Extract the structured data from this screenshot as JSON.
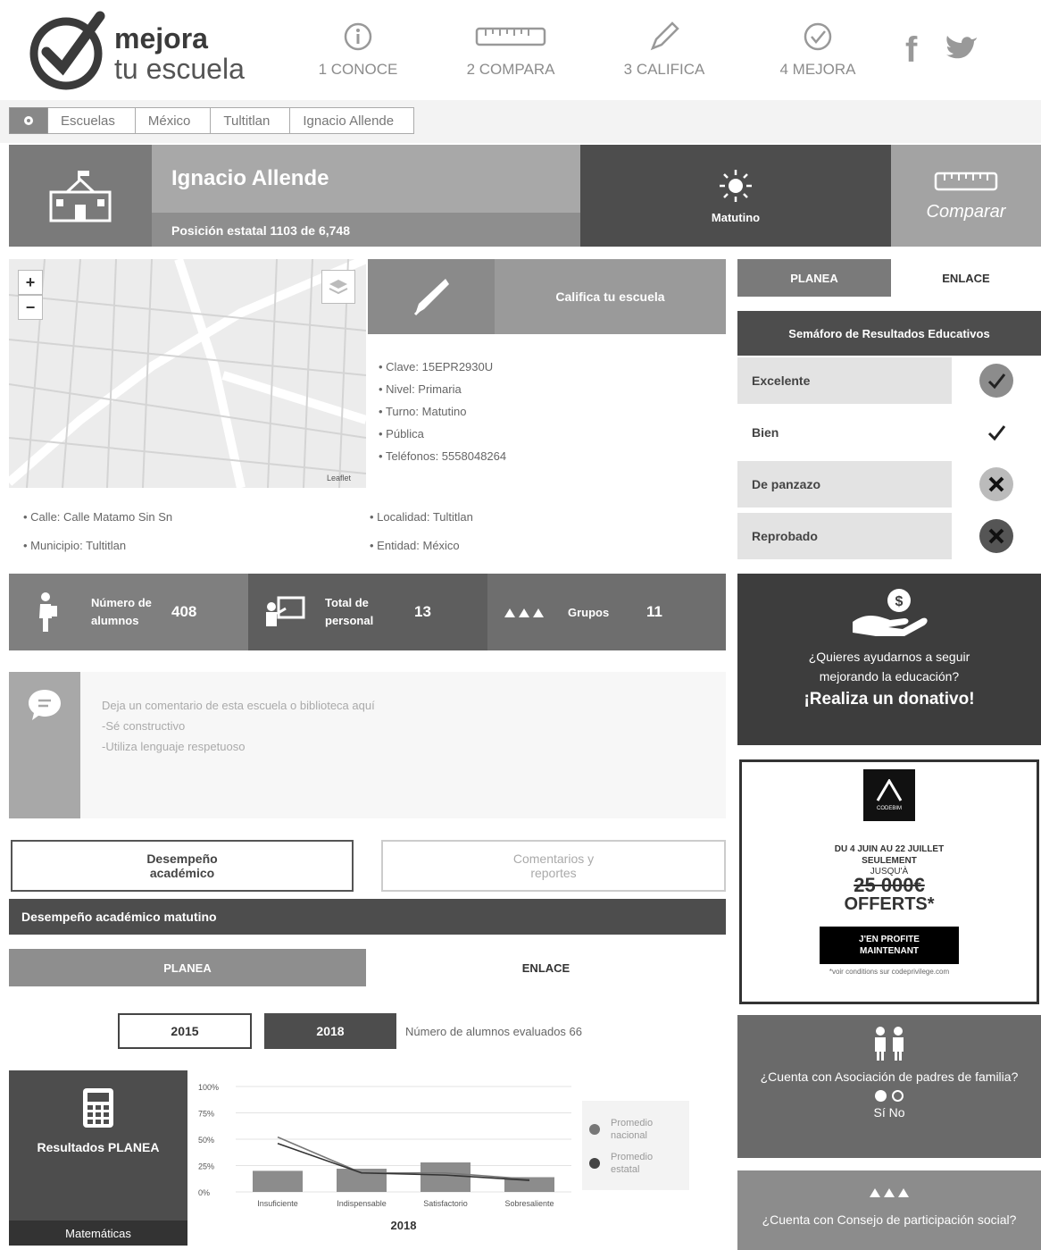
{
  "header": {
    "logo_line1": "mejora",
    "logo_line2": "tu escuela",
    "steps": [
      {
        "label": "1 CONOCE",
        "icon": "info-circle-icon"
      },
      {
        "label": "2 COMPARA",
        "icon": "ruler-icon"
      },
      {
        "label": "3 CALIFICA",
        "icon": "pencil-icon"
      },
      {
        "label": "4 MEJORA",
        "icon": "check-circle-icon"
      }
    ],
    "social": [
      "f",
      "twitter"
    ]
  },
  "breadcrumb": [
    "Escuelas",
    "México",
    "Tultitlan",
    "Ignacio Allende"
  ],
  "school": {
    "name": "Ignacio Allende",
    "position": "Posición estatal 1103 de 6,748",
    "shift": "Matutino",
    "compare_label": "Comparar"
  },
  "rate": {
    "label": "Califica tu escuela"
  },
  "details": [
    "Clave: 15EPR2930U",
    "Nivel: Primaria",
    "Turno: Matutino",
    "Pública",
    "Teléfonos: 5558048264"
  ],
  "address": {
    "calle": "Calle: Calle Matamo Sin Sn",
    "municipio": "Municipio: Tultitlan",
    "localidad": "Localidad: Tultitlan",
    "entidad": "Entidad: México"
  },
  "map": {
    "zoom_in": "+",
    "zoom_out": "−",
    "attribution": "Leaflet"
  },
  "stats": [
    {
      "label": "Número de alumnos",
      "value": "408"
    },
    {
      "label": "Total de personal",
      "value": "13"
    },
    {
      "label": "Grupos",
      "value": "11"
    }
  ],
  "comment": {
    "placeholder": "Deja un comentario de esta escuela o biblioteca aquí",
    "line2": "-Sé constructivo",
    "line3": "-Utiliza lenguaje respetuoso"
  },
  "tabs": {
    "desempeno": "Desempeño académico",
    "comentarios": "Comentarios y reportes"
  },
  "section_title": "Desempeño académico matutino",
  "subtabs": {
    "planea": "PLANEA",
    "enlace": "ENLACE"
  },
  "years": {
    "y2015": "2015",
    "y2018": "2018",
    "evaluated": "Número de alumnos evaluados 66"
  },
  "results": {
    "title": "Resultados PLANEA",
    "subject": "Matemáticas"
  },
  "chart_data": {
    "type": "bar",
    "categories": [
      "Insuficiente",
      "Indispensable",
      "Satisfactorio",
      "Sobresaliente"
    ],
    "series": [
      {
        "name": "",
        "values": [
          20,
          22,
          28,
          14
        ]
      },
      {
        "name": "Promedio nacional",
        "values": [
          52,
          18,
          18,
          12
        ]
      },
      {
        "name": "Promedio estatal",
        "values": [
          46,
          18,
          16,
          11
        ]
      }
    ],
    "yticks": [
      "100%",
      "75%",
      "50%",
      "25%",
      "0%"
    ],
    "ylim": [
      0,
      100
    ],
    "xlabel": "2018",
    "legend": [
      "Promedio nacional",
      "Promedio estatal"
    ],
    "legend_position": "right"
  },
  "side": {
    "planea": "PLANEA",
    "enlace": "ENLACE",
    "semaforo_title": "Semáforo de Resultados Educativos",
    "semaforo": [
      "Excelente",
      "Bien",
      "De panzazo",
      "Reprobado"
    ],
    "donate_q": "¿Quieres ayudarnos a seguir mejorando la educación?",
    "donate_cta": "¡Realiza un donativo!",
    "ad": {
      "brand": "CODEBIM",
      "dates": "DU 4 JUIN AU 22 JUILLET",
      "seulement": "SEULEMENT",
      "jusqua": "JUSQU'À",
      "price": "25 000€",
      "offerts": "OFFERTS*",
      "cta": "J'EN PROFITE MAINTENANT",
      "fine": "*voir conditions sur codeprivilege.com"
    },
    "parents_q": "¿Cuenta con Asociación de padres de familia?",
    "parents_opts": "Sí No",
    "council_q": "¿Cuenta con Consejo de participación social?"
  }
}
